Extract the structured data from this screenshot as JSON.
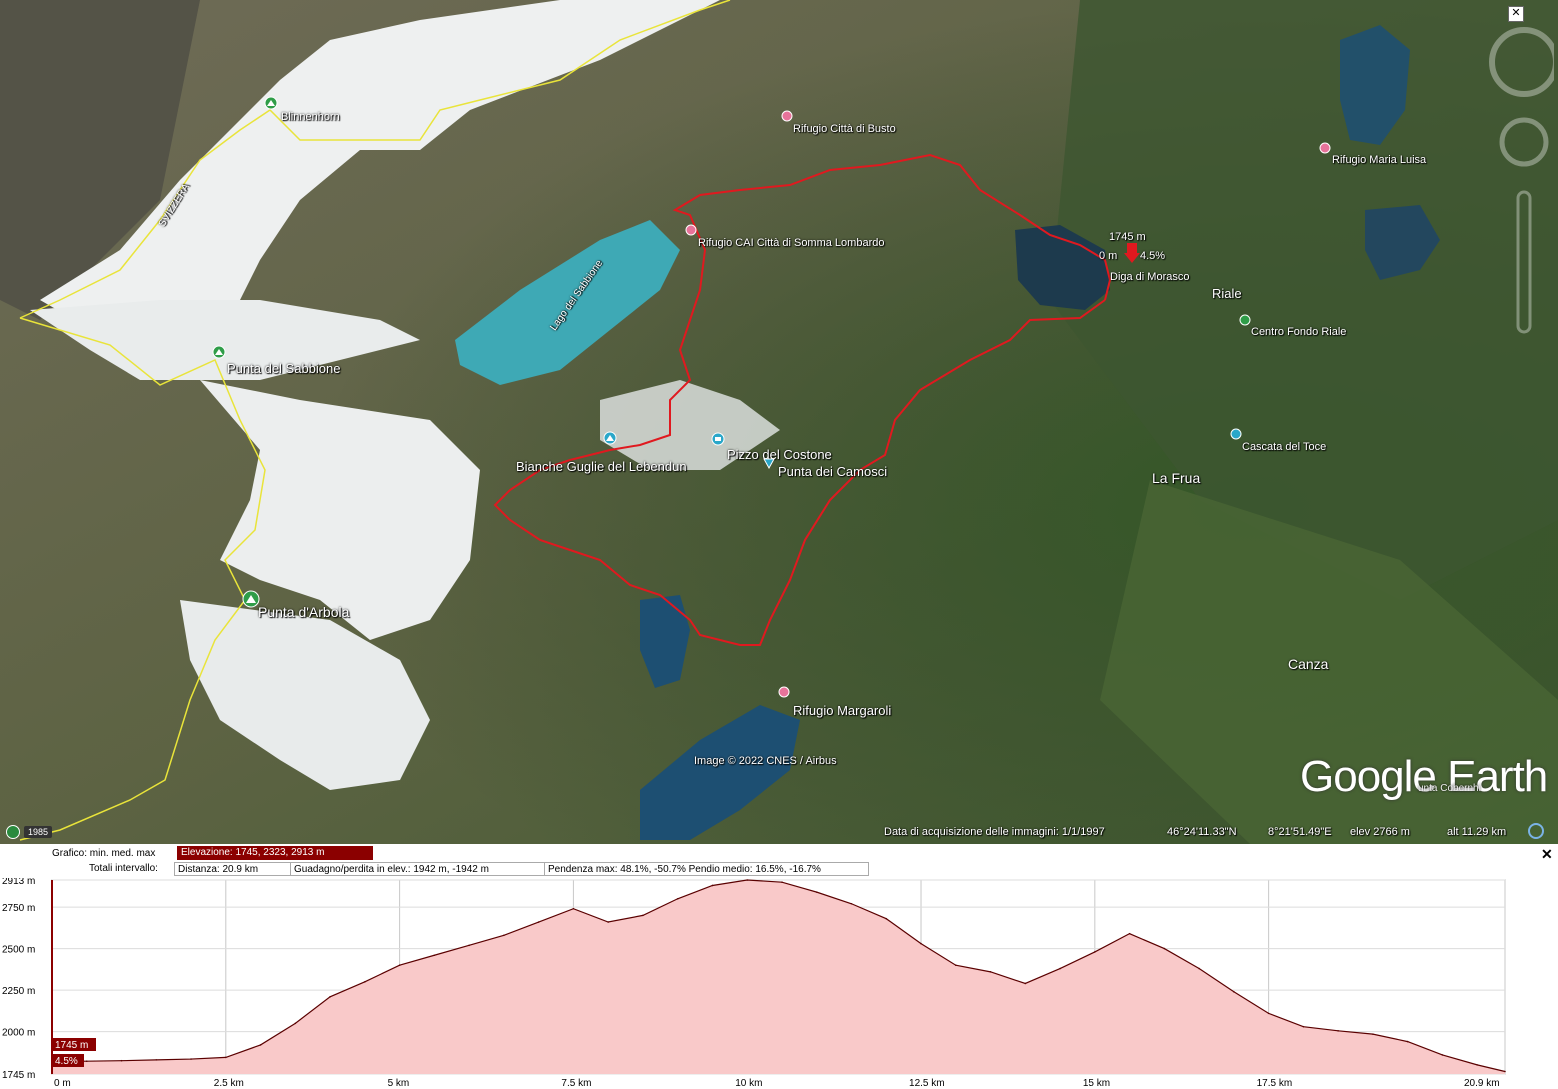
{
  "map": {
    "places": [
      {
        "name": "Blinnenhorn",
        "kind": "peak"
      },
      {
        "name": "SVIZZERA",
        "kind": "border"
      },
      {
        "name": "Rifugio Città di Busto",
        "kind": "hut"
      },
      {
        "name": "Rifugio Maria Luisa",
        "kind": "hut"
      },
      {
        "name": "Rifugio CAI Città di Somma Lombardo",
        "kind": "hut"
      },
      {
        "name": "Lago del Sabbione",
        "kind": "lake"
      },
      {
        "name": "Diga di Morasco",
        "kind": "dam"
      },
      {
        "name": "Riale",
        "kind": "town"
      },
      {
        "name": "Centro Fondo Riale",
        "kind": "poi"
      },
      {
        "name": "Punta del Sabbione",
        "kind": "peak"
      },
      {
        "name": "Bianche Guglie del Lebendun",
        "kind": "peak"
      },
      {
        "name": "Pizzo del Costone",
        "kind": "photo"
      },
      {
        "name": "Punta dei Camosci",
        "kind": "poi"
      },
      {
        "name": "Cascata del Toce",
        "kind": "poi"
      },
      {
        "name": "La Frua",
        "kind": "town"
      },
      {
        "name": "Punta d'Arbola",
        "kind": "peak"
      },
      {
        "name": "Canza",
        "kind": "town"
      },
      {
        "name": "Rifugio Margaroli",
        "kind": "hut"
      }
    ],
    "cursor": {
      "elevation": "1745 m",
      "distance": "0 m",
      "slope": "4.5%"
    },
    "attribution": "Image © 2022 CNES / Airbus",
    "logo": "Google Earth",
    "logo_sub": "unta Cobernhi",
    "year": "1985",
    "status": {
      "acq_date": "Data di acquisizione delle immagini: 1/1/1997",
      "lat": "46°24'11.33\"N",
      "lon": "8°21'51.49\"E",
      "elev": "elev  2766 m",
      "alt": "alt  11.29 km"
    }
  },
  "profile": {
    "header": {
      "grafico_label": "Grafico: min. med. max",
      "elevazione": "Elevazione: 1745, 2323, 2913 m",
      "totali_label": "Totali intervallo:",
      "distanza": "Distanza: 20.9 km",
      "guadagno": "Guadagno/perdita in elev.: 1942 m, -1942 m",
      "pendenza": "Pendenza max: 48.1%, -50.7% Pendio medio: 16.5%, -16.7%"
    },
    "close": "✕",
    "cursor_elev": "1745 m",
    "cursor_slope": "4.5%"
  },
  "chart_data": {
    "type": "area",
    "xlabel": "",
    "ylabel": "",
    "xlim": [
      0,
      20.9
    ],
    "ylim": [
      1745,
      2913
    ],
    "xticks": [
      "0 m",
      "2.5 km",
      "5 km",
      "7.5 km",
      "10 km",
      "12.5 km",
      "15 km",
      "17.5 km",
      "20.9 km"
    ],
    "yticks": [
      "2913 m",
      "2750 m",
      "2500 m",
      "2250 m",
      "2000 m",
      "1745 m"
    ],
    "x": [
      0,
      0.5,
      1,
      1.5,
      2,
      2.5,
      3,
      3.5,
      4,
      4.5,
      5,
      5.5,
      6,
      6.5,
      7,
      7.5,
      8,
      8.5,
      9,
      9.5,
      10,
      10.5,
      11,
      11.5,
      12,
      12.5,
      13,
      13.5,
      14,
      14.5,
      15,
      15.5,
      16,
      16.5,
      17,
      17.5,
      18,
      18.5,
      19,
      19.5,
      20,
      20.5,
      20.9
    ],
    "y": [
      1820,
      1822,
      1825,
      1830,
      1835,
      1845,
      1920,
      2050,
      2210,
      2300,
      2400,
      2460,
      2520,
      2580,
      2660,
      2740,
      2660,
      2700,
      2800,
      2880,
      2913,
      2900,
      2840,
      2770,
      2680,
      2530,
      2400,
      2360,
      2290,
      2380,
      2480,
      2590,
      2500,
      2380,
      2240,
      2110,
      2030,
      2005,
      1985,
      1940,
      1860,
      1800,
      1760
    ],
    "series": [
      {
        "values": []
      }
    ],
    "colors": {
      "fill": "#f9c9c9",
      "line": "#5a0000",
      "bg": "#ffffff"
    },
    "grid": true
  }
}
